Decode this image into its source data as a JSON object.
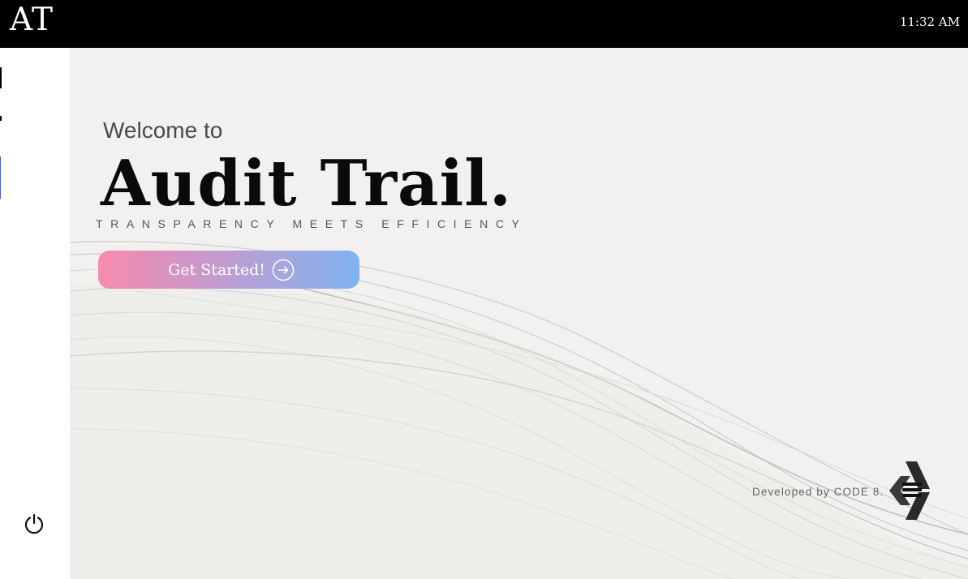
{
  "header": {
    "app_logo": "AT",
    "clock": "11:32 AM"
  },
  "sidebar": {
    "power_icon": "power-icon"
  },
  "hero": {
    "welcome": "Welcome to",
    "title": "Audit Trail.",
    "tagline": "TRANSPARENCY MEETS EFFICIENCY",
    "cta_label": "Get Started!",
    "cta_icon": "arrow-right-circle-icon"
  },
  "footer": {
    "credit": "Developed by CODE 8.",
    "brand_icon": "code8-logo-icon"
  },
  "colors": {
    "header_bg": "#000000",
    "main_bg": "#f2f1ef",
    "cta_gradient_start": "#f88aaf",
    "cta_gradient_end": "#7fb3f1"
  }
}
